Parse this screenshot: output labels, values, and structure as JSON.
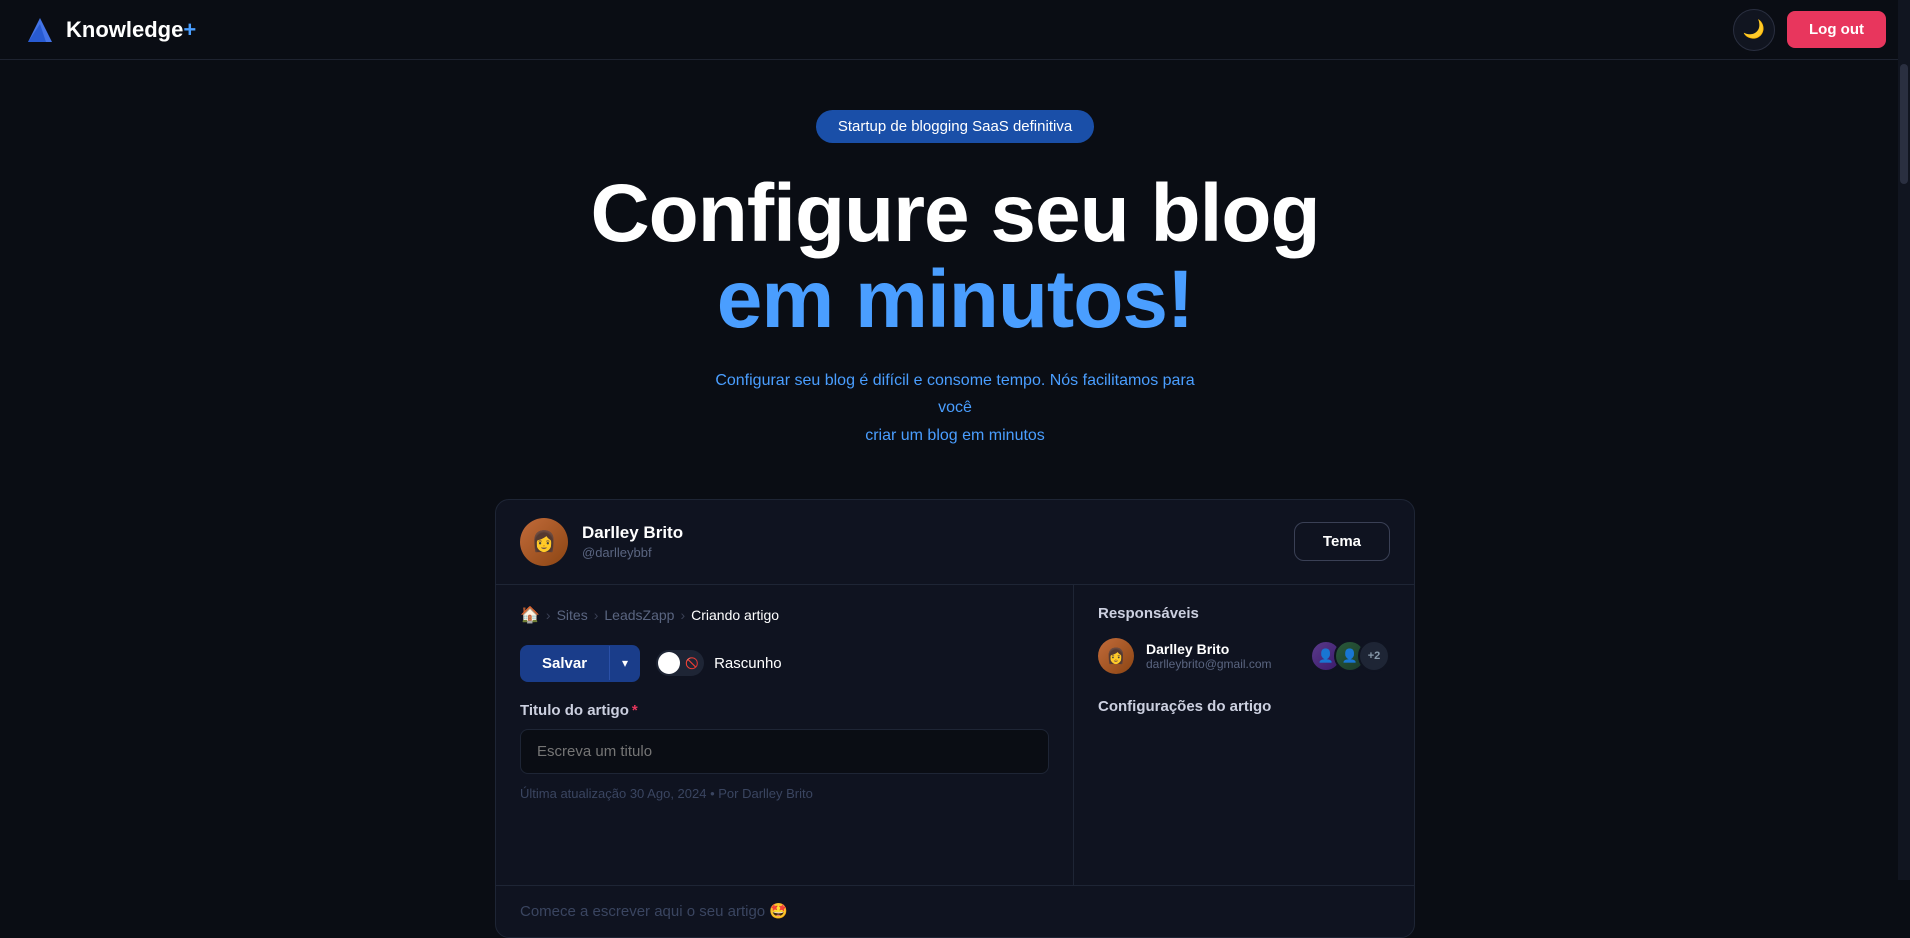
{
  "navbar": {
    "logo_text": "Knowledge",
    "logo_plus": "+",
    "theme_icon": "🌙",
    "logout_label": "Log out"
  },
  "hero": {
    "badge": "Startup de blogging SaaS definitiva",
    "title_white": "Configure seu blog",
    "title_blue": "em minutos!",
    "subtitle_line1": "Configurar seu blog é difícil e consome tempo. Nós facilitamos para você",
    "subtitle_line2": "criar um blog em minutos"
  },
  "demo_card": {
    "user": {
      "name": "Darlley Brito",
      "handle": "@darlleybbf"
    },
    "tema_label": "Tema",
    "breadcrumb": {
      "home_icon": "🏠",
      "sites": "Sites",
      "site_name": "LeadsZapp",
      "current": "Criando artigo"
    },
    "toolbar": {
      "save_label": "Salvar",
      "draft_label": "Rascunho"
    },
    "form": {
      "field_label": "Titulo do artigo",
      "placeholder": "Escreva um titulo",
      "last_update": "Última atualização 30 Ago, 2024  •  Por Darlley Brito"
    },
    "editor": {
      "placeholder": "Comece a escrever aqui o seu artigo 🤩"
    },
    "responsaveis": {
      "section_title": "Responsáveis",
      "user_name": "Darlley Brito",
      "user_email": "darlleybrito@gmail.com",
      "extra_count": "+2"
    },
    "config_section": {
      "title": "Configurações do artigo"
    }
  }
}
